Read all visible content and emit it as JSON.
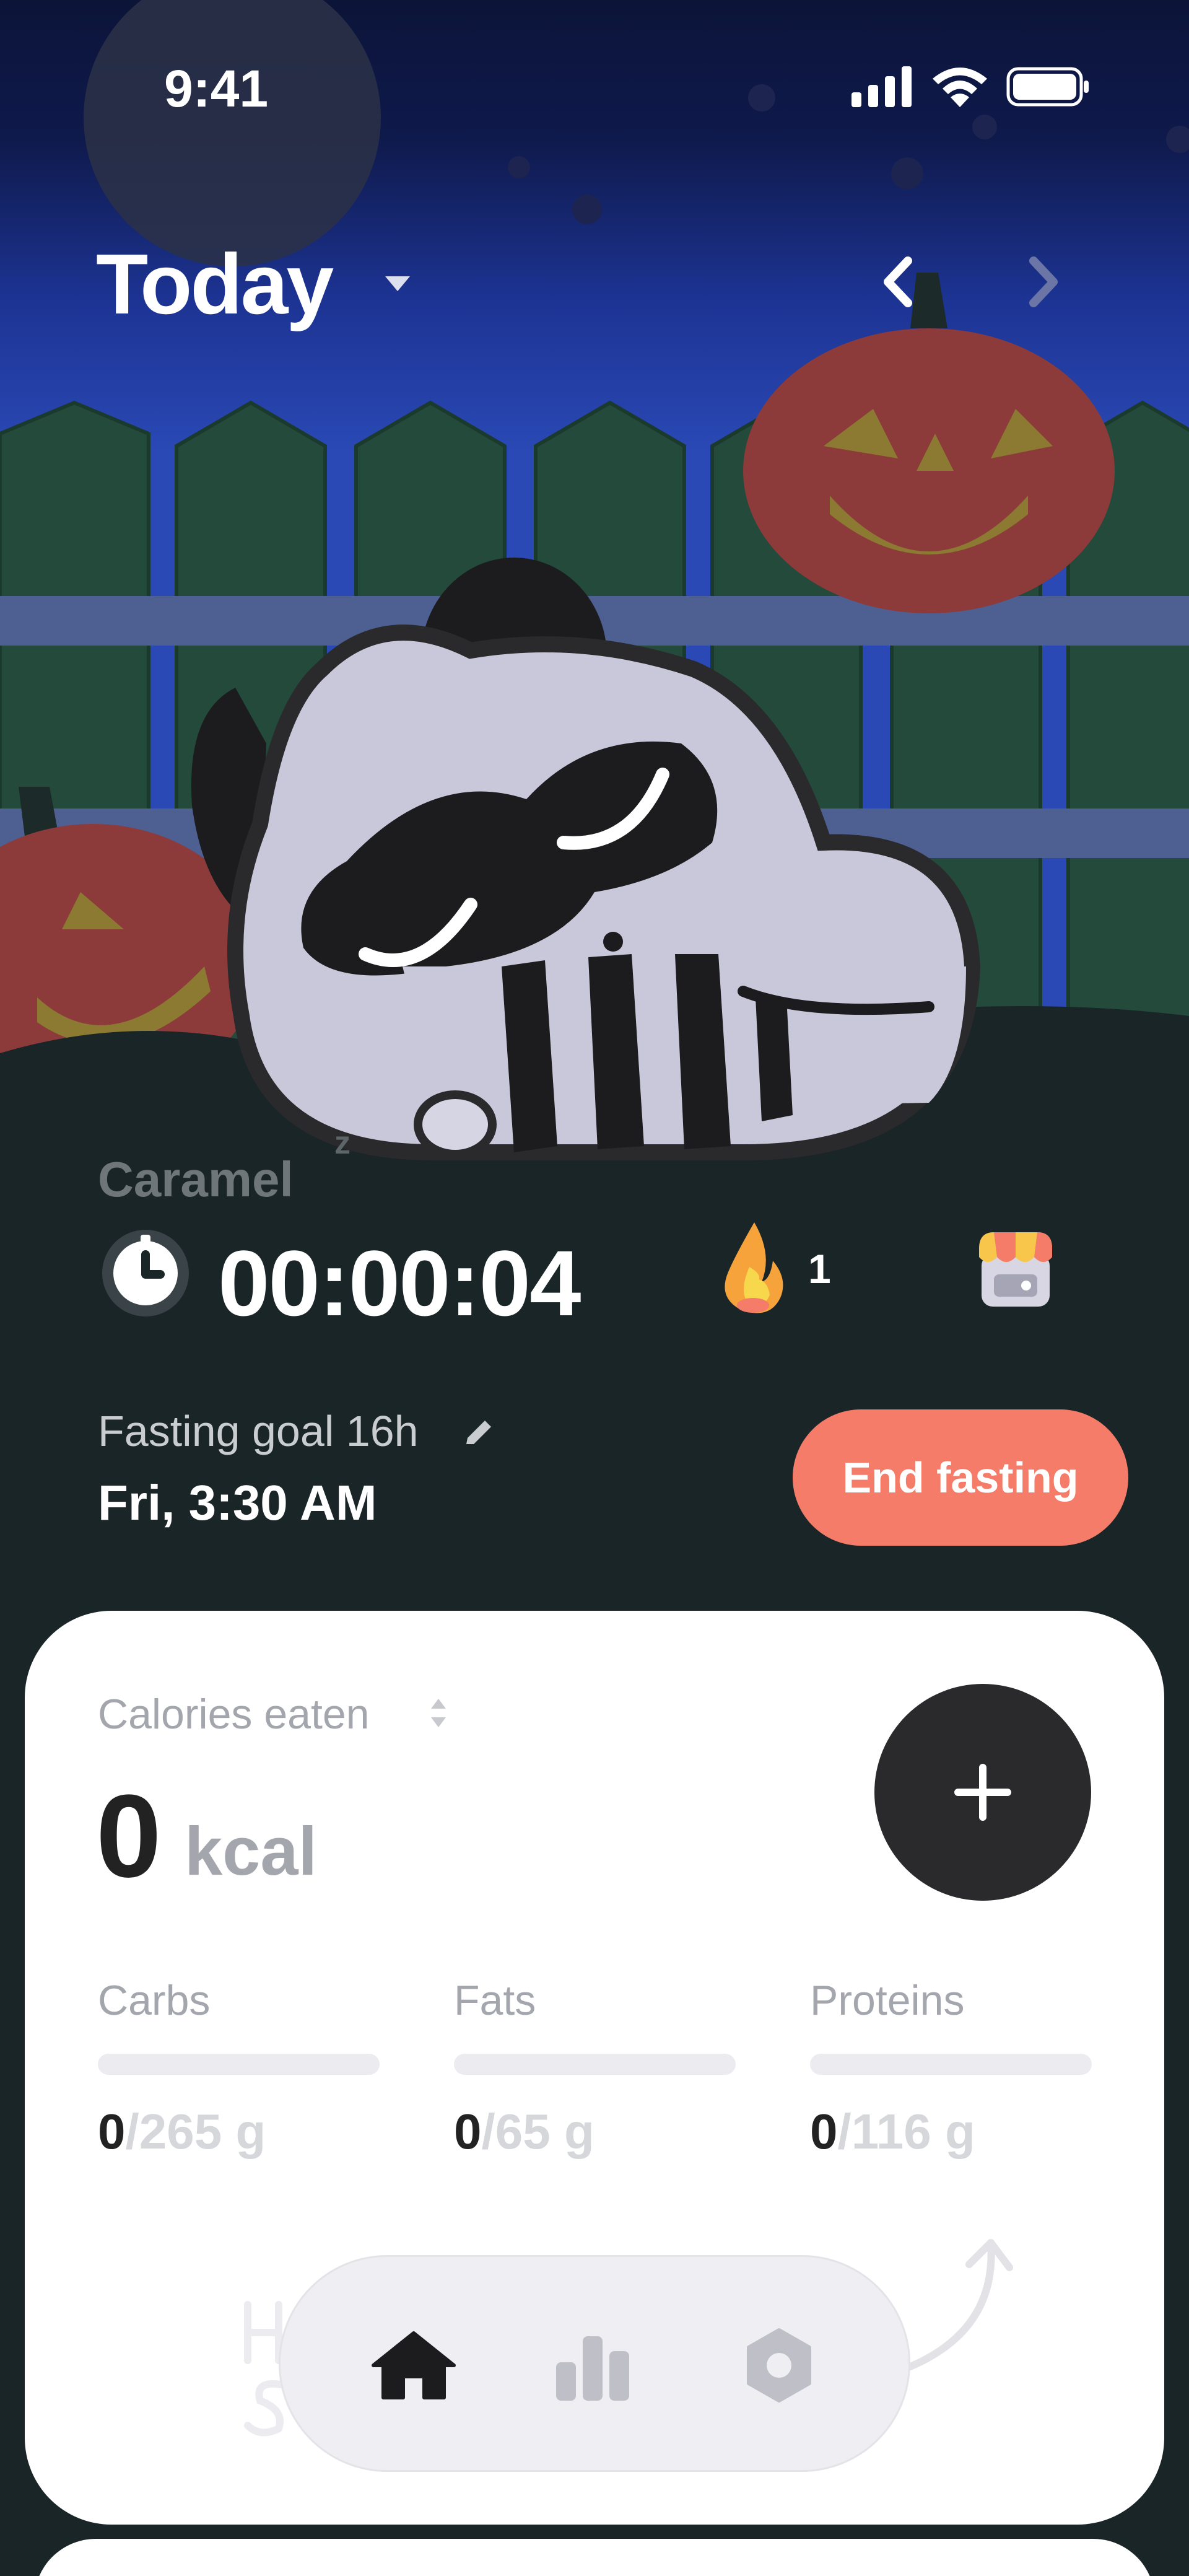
{
  "status_bar": {
    "time": "9:41"
  },
  "header": {
    "title": "Today"
  },
  "pet": {
    "name": "Caramel",
    "sleep_mark": "z"
  },
  "timer": {
    "elapsed": "00:00:04"
  },
  "streak": {
    "count": "1"
  },
  "fasting": {
    "goal_label": "Fasting goal 16h",
    "end_time": "Fri, 3:30 AM",
    "end_button_label": "End fasting"
  },
  "calories": {
    "label": "Calories eaten",
    "value": "0",
    "unit": "kcal"
  },
  "macros": [
    {
      "name": "Carbs",
      "value": "0",
      "goal": "/265 g",
      "progress": 0
    },
    {
      "name": "Fats",
      "value": "0",
      "goal": "/65 g",
      "progress": 0
    },
    {
      "name": "Proteins",
      "value": "0",
      "goal": "/116 g",
      "progress": 0
    }
  ],
  "tab_bar": {
    "tabs": [
      {
        "name": "home",
        "icon": "home-icon",
        "active": true
      },
      {
        "name": "stats",
        "icon": "bar-chart-icon",
        "active": false
      },
      {
        "name": "settings",
        "icon": "settings-icon",
        "active": false
      }
    ]
  },
  "colors": {
    "background": "#1a2528",
    "accent": "#f47c68",
    "sky_top": "#0e1642",
    "sky_bottom": "#2a4bb8",
    "fence": "#234a3a",
    "pumpkin": "#8c3b3a",
    "card": "#ffffff",
    "text_muted": "#a4a6ad"
  }
}
